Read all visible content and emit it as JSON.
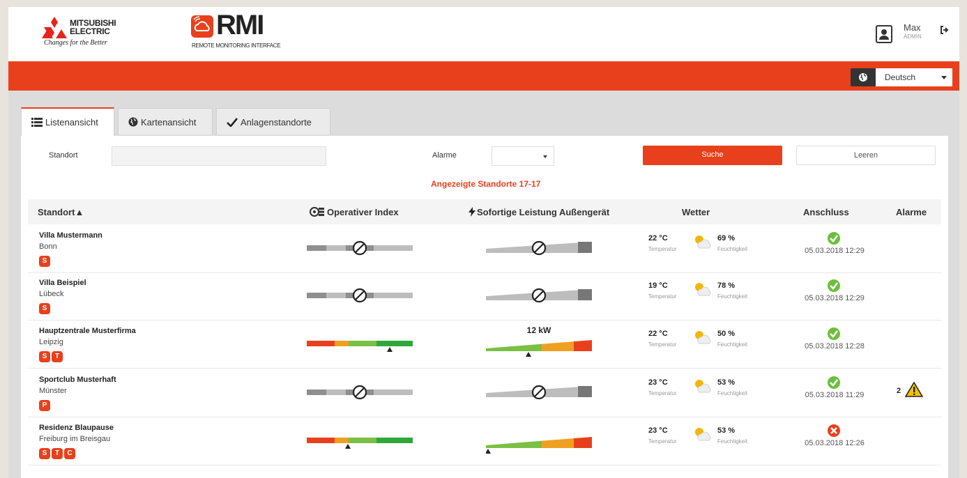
{
  "brand": {
    "company_line1": "MITSUBISHI",
    "company_line2": "ELECTRIC",
    "tagline": "Changes for the Better",
    "product": "RMI",
    "product_sub": "REMOTE MONITORING INTERFACE"
  },
  "user": {
    "name": "Max",
    "role": "ADMIN"
  },
  "language": {
    "selected": "Deutsch"
  },
  "tabs": [
    {
      "label": "Listenansicht",
      "icon": "list-icon",
      "active": true
    },
    {
      "label": "Kartenansicht",
      "icon": "globe-icon",
      "active": false
    },
    {
      "label": "Anlagenstandorte",
      "icon": "check-icon",
      "active": false
    }
  ],
  "filters": {
    "standort_label": "Standort",
    "standort_value": "",
    "alarme_label": "Alarme",
    "alarme_value": "",
    "search_label": "Suche",
    "clear_label": "Leeren"
  },
  "count_text": "Angezeigte Standorte 17-17",
  "table": {
    "headers": {
      "standort": "Standort▲",
      "operativer_index": "Operativer Index",
      "leistung": "Sofortige Leistung Außengerät",
      "wetter": "Wetter",
      "anschluss": "Anschluss",
      "alarme": "Alarme"
    },
    "rows": [
      {
        "name": "Villa Mustermann",
        "city": "Bonn",
        "badges": [
          "S"
        ],
        "op_status": "disabled",
        "power_status": "disabled",
        "power_label": "",
        "temp": "22 °C",
        "temp_label": "Temperatur",
        "humidity": "69 %",
        "humidity_label": "Feuchtigkeit",
        "connection": "ok",
        "conn_time": "05.03.2018 12:29",
        "alarms": ""
      },
      {
        "name": "Villa Beispiel",
        "city": "Lübeck",
        "badges": [
          "S"
        ],
        "op_status": "disabled",
        "power_status": "disabled",
        "power_label": "",
        "temp": "19 °C",
        "temp_label": "Temperatur",
        "humidity": "78 %",
        "humidity_label": "Feuchtigkeit",
        "connection": "ok",
        "conn_time": "05.03.2018 12:29",
        "alarms": ""
      },
      {
        "name": "Hauptzentrale Musterfirma",
        "city": "Leipzig",
        "badges": [
          "S",
          "T"
        ],
        "op_status": "active",
        "op_marker": 0.78,
        "power_status": "active",
        "power_marker": 0.4,
        "power_label": "12 kW",
        "temp": "22 °C",
        "temp_label": "Temperatur",
        "humidity": "50 %",
        "humidity_label": "Feuchtigkeit",
        "connection": "ok",
        "conn_time": "05.03.2018 12:28",
        "alarms": ""
      },
      {
        "name": "Sportclub Musterhaft",
        "city": "Münster",
        "badges": [
          "P"
        ],
        "op_status": "disabled",
        "power_status": "disabled",
        "power_label": "",
        "temp": "23 °C",
        "temp_label": "Temperatur",
        "humidity": "53 %",
        "humidity_label": "Feuchtigkeit",
        "connection": "ok",
        "conn_time": "05.03.2018 11:29",
        "alarms": "2"
      },
      {
        "name": "Residenz Blaupause",
        "city": "Freiburg im Breisgau",
        "badges": [
          "S",
          "T",
          "C"
        ],
        "op_status": "active",
        "op_marker": 0.39,
        "power_status": "active",
        "power_marker": 0.02,
        "power_label": "",
        "temp": "23 °C",
        "temp_label": "Temperatur",
        "humidity": "53 %",
        "humidity_label": "Feuchtigkeit",
        "connection": "error",
        "conn_time": "05.03.2018 12:26",
        "alarms": ""
      }
    ]
  },
  "colors": {
    "brand_red": "#e8401c",
    "ok_green": "#6cbf3c",
    "error_red": "#e8401c",
    "warning_yellow": "#f2c200"
  }
}
